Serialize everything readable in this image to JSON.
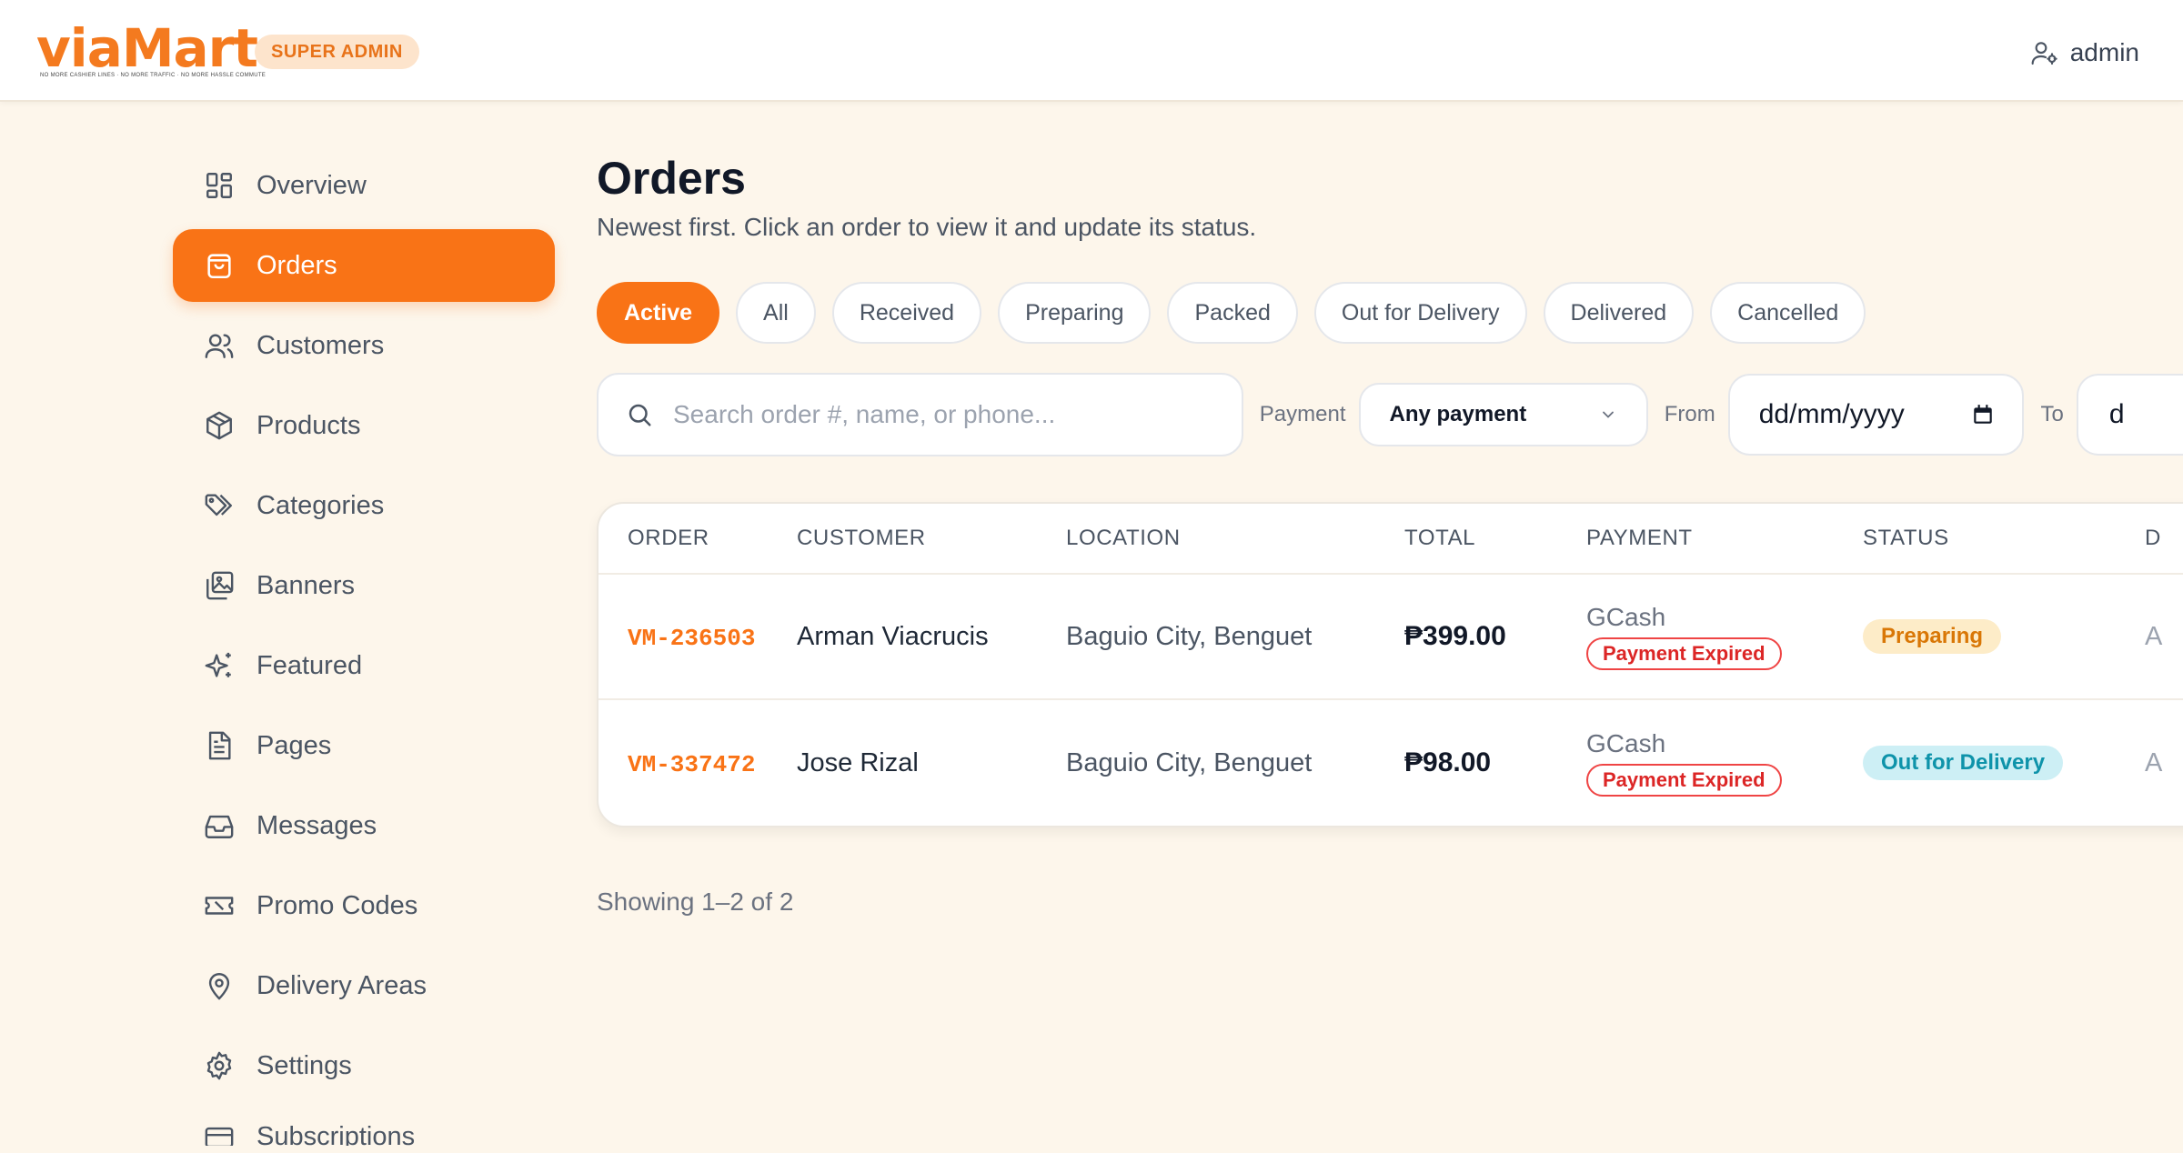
{
  "header": {
    "logo_text": "viaMart",
    "logo_tagline": "NO MORE CASHIER LINES · NO MORE TRAFFIC · NO MORE HASSLE COMMUTE",
    "role_badge": "SUPER ADMIN",
    "user_name": "admin"
  },
  "sidebar": {
    "items": [
      {
        "label": "Overview",
        "icon": "grid-icon"
      },
      {
        "label": "Orders",
        "icon": "shopping-bag-icon",
        "active": true
      },
      {
        "label": "Customers",
        "icon": "users-icon"
      },
      {
        "label": "Products",
        "icon": "box-icon"
      },
      {
        "label": "Categories",
        "icon": "tags-icon"
      },
      {
        "label": "Banners",
        "icon": "images-icon"
      },
      {
        "label": "Featured",
        "icon": "sparkles-icon"
      },
      {
        "label": "Pages",
        "icon": "file-icon"
      },
      {
        "label": "Messages",
        "icon": "inbox-icon"
      },
      {
        "label": "Promo Codes",
        "icon": "ticket-icon"
      },
      {
        "label": "Delivery Areas",
        "icon": "map-pin-icon"
      },
      {
        "label": "Settings",
        "icon": "gear-icon"
      },
      {
        "label": "Subscriptions",
        "icon": "card-icon"
      }
    ]
  },
  "main": {
    "title": "Orders",
    "subtitle": "Newest first. Click an order to view it and update its status.",
    "filters": [
      "Active",
      "All",
      "Received",
      "Preparing",
      "Packed",
      "Out for Delivery",
      "Delivered",
      "Cancelled"
    ],
    "active_filter": "Active",
    "search": {
      "placeholder": "Search order #, name, or phone...",
      "value": ""
    },
    "payment_label": "Payment",
    "payment_select": "Any payment",
    "from_label": "From",
    "from_value": "dd/mm/yyyy",
    "to_label": "To",
    "to_value": "d",
    "table": {
      "columns": [
        "ORDER",
        "CUSTOMER",
        "LOCATION",
        "TOTAL",
        "PAYMENT",
        "STATUS",
        "D"
      ],
      "rows": [
        {
          "order": "VM-236503",
          "customer": "Arman Viacrucis",
          "location": "Baguio City, Benguet",
          "total": "₱399.00",
          "payment_method": "GCash",
          "payment_status": "Payment Expired",
          "status": "Preparing",
          "date": "A"
        },
        {
          "order": "VM-337472",
          "customer": "Jose Rizal",
          "location": "Baguio City, Benguet",
          "total": "₱98.00",
          "payment_method": "GCash",
          "payment_status": "Payment Expired",
          "status": "Out for Delivery",
          "date": "A"
        }
      ]
    },
    "showing": "Showing 1–2 of 2"
  },
  "colors": {
    "accent": "#f97316",
    "background": "#fdf6eb",
    "status_preparing": "#d97706",
    "status_delivery": "#0e93aa",
    "payment_expired": "#dc2626"
  }
}
